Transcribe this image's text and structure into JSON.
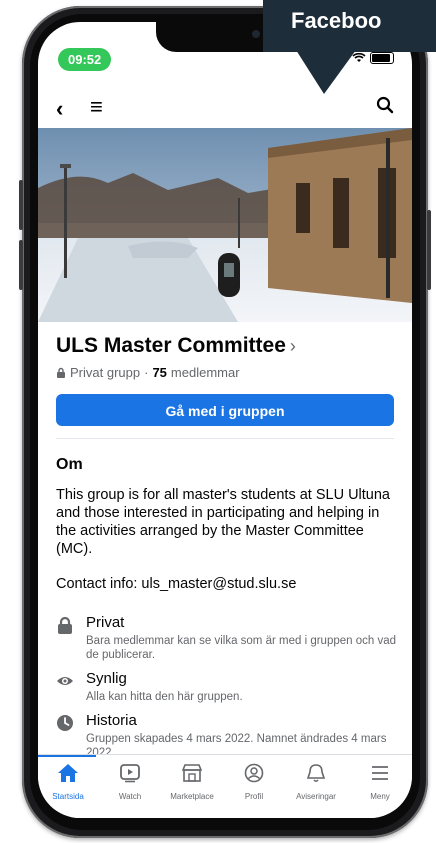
{
  "banner": {
    "text": "Faceboo"
  },
  "status_bar": {
    "time": "09:52"
  },
  "group": {
    "name": "ULS Master Committee",
    "chevron": "›",
    "privacy": "Privat grupp",
    "separator": "·",
    "member_count": "75",
    "member_label": "medlemmar",
    "join_button": "Gå med i gruppen"
  },
  "about": {
    "heading": "Om",
    "description": "This group is for all master's students at SLU Ultuna and those interested in participating and helping in the activities arranged by the Master Committee (MC).",
    "contact": "Contact info: uls_master@stud.slu.se",
    "items": [
      {
        "icon": "lock-icon",
        "title": "Privat",
        "desc": "Bara medlemmar kan se vilka som är med i gruppen och vad de publicerar."
      },
      {
        "icon": "eye-icon",
        "title": "Synlig",
        "desc": "Alla kan hitta den här gruppen."
      },
      {
        "icon": "clock-icon",
        "title": "Historia",
        "desc": "Gruppen skapades 4 mars 2022. Namnet ändrades 4 mars 2022."
      }
    ]
  },
  "tabbar": {
    "items": [
      {
        "label": "Startsida",
        "icon": "home-icon",
        "active": true
      },
      {
        "label": "Watch",
        "icon": "watch-icon",
        "active": false
      },
      {
        "label": "Marketplace",
        "icon": "marketplace-icon",
        "active": false
      },
      {
        "label": "Profil",
        "icon": "profile-icon",
        "active": false
      },
      {
        "label": "Aviseringar",
        "icon": "bell-icon",
        "active": false
      },
      {
        "label": "Meny",
        "icon": "menu-icon",
        "active": false
      }
    ]
  },
  "colors": {
    "accent": "#1b74e4",
    "status_green": "#34c759",
    "banner": "#1d2d3a"
  }
}
